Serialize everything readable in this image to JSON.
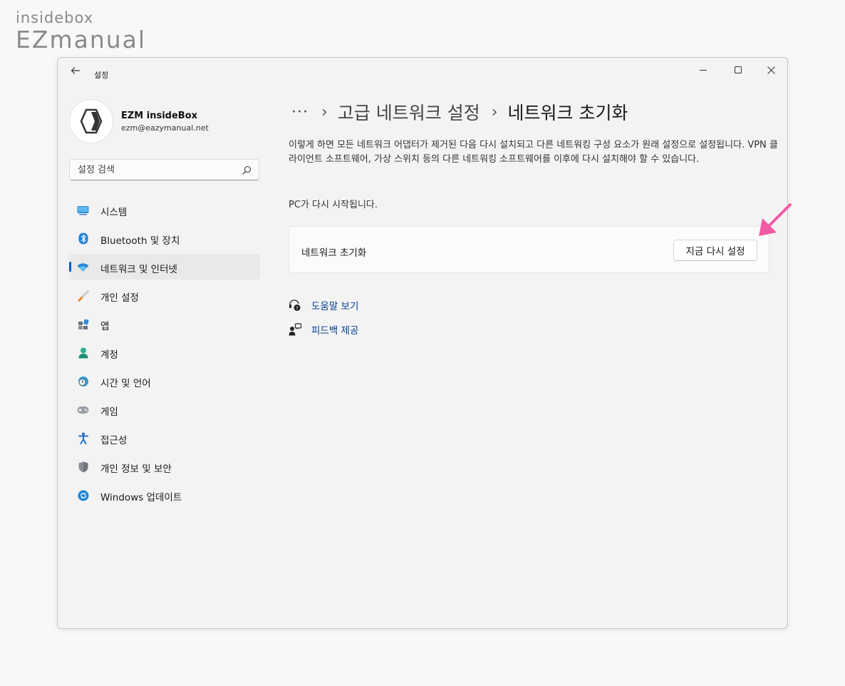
{
  "watermark": {
    "line1": "insidebox",
    "line2": "EZmanual"
  },
  "window": {
    "title": "설정"
  },
  "profile": {
    "name": "EZM insideBox",
    "email": "ezm@eazymanual.net"
  },
  "search": {
    "placeholder": "설정 검색"
  },
  "nav": {
    "items": [
      {
        "label": "시스템",
        "icon": "monitor-icon"
      },
      {
        "label": "Bluetooth 및 장치",
        "icon": "bluetooth-icon"
      },
      {
        "label": "네트워크 및 인터넷",
        "icon": "wifi-icon",
        "active": true
      },
      {
        "label": "개인 설정",
        "icon": "brush-icon"
      },
      {
        "label": "앱",
        "icon": "apps-icon"
      },
      {
        "label": "계정",
        "icon": "person-icon"
      },
      {
        "label": "시간 및 언어",
        "icon": "globe-clock-icon"
      },
      {
        "label": "게임",
        "icon": "gamepad-icon"
      },
      {
        "label": "접근성",
        "icon": "accessibility-icon"
      },
      {
        "label": "개인 정보 및 보안",
        "icon": "shield-icon"
      },
      {
        "label": "Windows 업데이트",
        "icon": "update-icon"
      }
    ]
  },
  "breadcrumb": {
    "more": "···",
    "parent": "고급 네트워크 설정",
    "current": "네트워크 초기화"
  },
  "content": {
    "description": "이렇게 하면 모든 네트워크 어댑터가 제거된 다음 다시 설치되고 다른 네트워킹 구성 요소가 원래 설정으로 설정됩니다. VPN 클라이언트 소프트웨어, 가상 스위치 등의 다른 네트워킹 소프트웨어를 이후에 다시 설치해야 할 수 있습니다.",
    "restart_note": "PC가 다시 시작됩니다.",
    "card_label": "네트워크 초기화",
    "reset_button": "지금 다시 설정",
    "help_link": "도움말 보기",
    "feedback_link": "피드백 제공"
  },
  "colors": {
    "accent": "#005fb8",
    "link": "#003e92",
    "annotation_arrow": "#f25ba3"
  }
}
